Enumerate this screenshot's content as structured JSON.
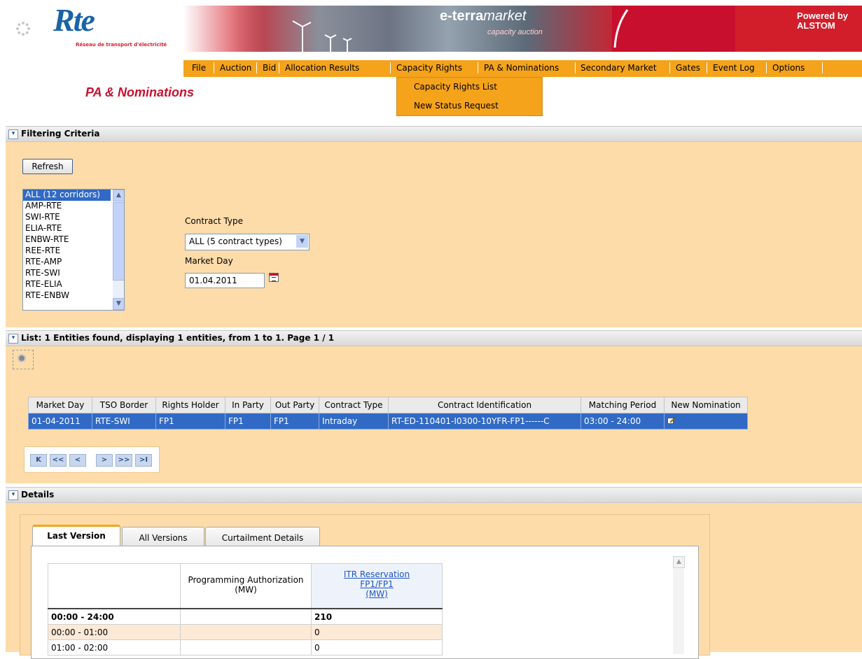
{
  "header": {
    "logo_text": "Rte",
    "logo_subtitle": "Réseau de transport d'électricité",
    "product_name_bold": "e-terra",
    "product_name_italic": "market",
    "product_subtitle": "capacity auction",
    "powered_by_line1": "Powered by",
    "powered_by_line2": "ALSTOM",
    "menu": [
      "File",
      "Auction",
      "Bid",
      "Allocation Results",
      "Capacity Rights",
      "PA & Nominations",
      "Secondary Market",
      "Gates",
      "Event Log",
      "Options"
    ],
    "open_menu": "Capacity Rights",
    "dropdown_items": [
      "Capacity Rights List",
      "New Status Request"
    ]
  },
  "page_title": "PA & Nominations",
  "filtering": {
    "title": "Filtering Criteria",
    "refresh_label": "Refresh",
    "corridors": [
      "ALL (12 corridors)",
      "AMP-RTE",
      "SWI-RTE",
      "ELIA-RTE",
      "ENBW-RTE",
      "REE-RTE",
      "RTE-AMP",
      "RTE-SWI",
      "RTE-ELIA",
      "RTE-ENBW"
    ],
    "selected_corridor": "ALL (12 corridors)",
    "contract_type_label": "Contract Type",
    "contract_type_value": "ALL (5 contract types)",
    "market_day_label": "Market Day",
    "market_day_value": "01.04.2011"
  },
  "list": {
    "title": "List: 1 Entities found, displaying 1 entities, from 1 to 1. Page 1 / 1",
    "columns": [
      "Market Day",
      "TSO Border",
      "Rights Holder",
      "In Party",
      "Out Party",
      "Contract Type",
      "Contract Identification",
      "Matching Period",
      "New Nomination"
    ],
    "rows": [
      [
        "01-04-2011",
        "RTE-SWI",
        "FP1",
        "FP1",
        "FP1",
        "Intraday",
        "RT-ED-110401-I0300-10YFR-FP1------C",
        "03:00 - 24:00",
        ""
      ]
    ],
    "pager": [
      "K",
      "<<",
      "<",
      ">",
      ">>",
      ">I"
    ]
  },
  "details": {
    "title": "Details",
    "tabs": [
      "Last Version",
      "All Versions",
      "Curtailment Details"
    ],
    "active_tab": "Last Version",
    "table": {
      "col_pa": "Programming Authorization (MW)",
      "itr_line1": "ITR Reservation",
      "itr_line2": "FP1/FP1",
      "itr_line3": "(MW)",
      "rows": [
        {
          "period": "00:00 - 24:00",
          "pa": "",
          "itr": "210"
        },
        {
          "period": "00:00 - 01:00",
          "pa": "",
          "itr": "0"
        },
        {
          "period": "01:00 - 02:00",
          "pa": "",
          "itr": "0"
        }
      ]
    }
  }
}
